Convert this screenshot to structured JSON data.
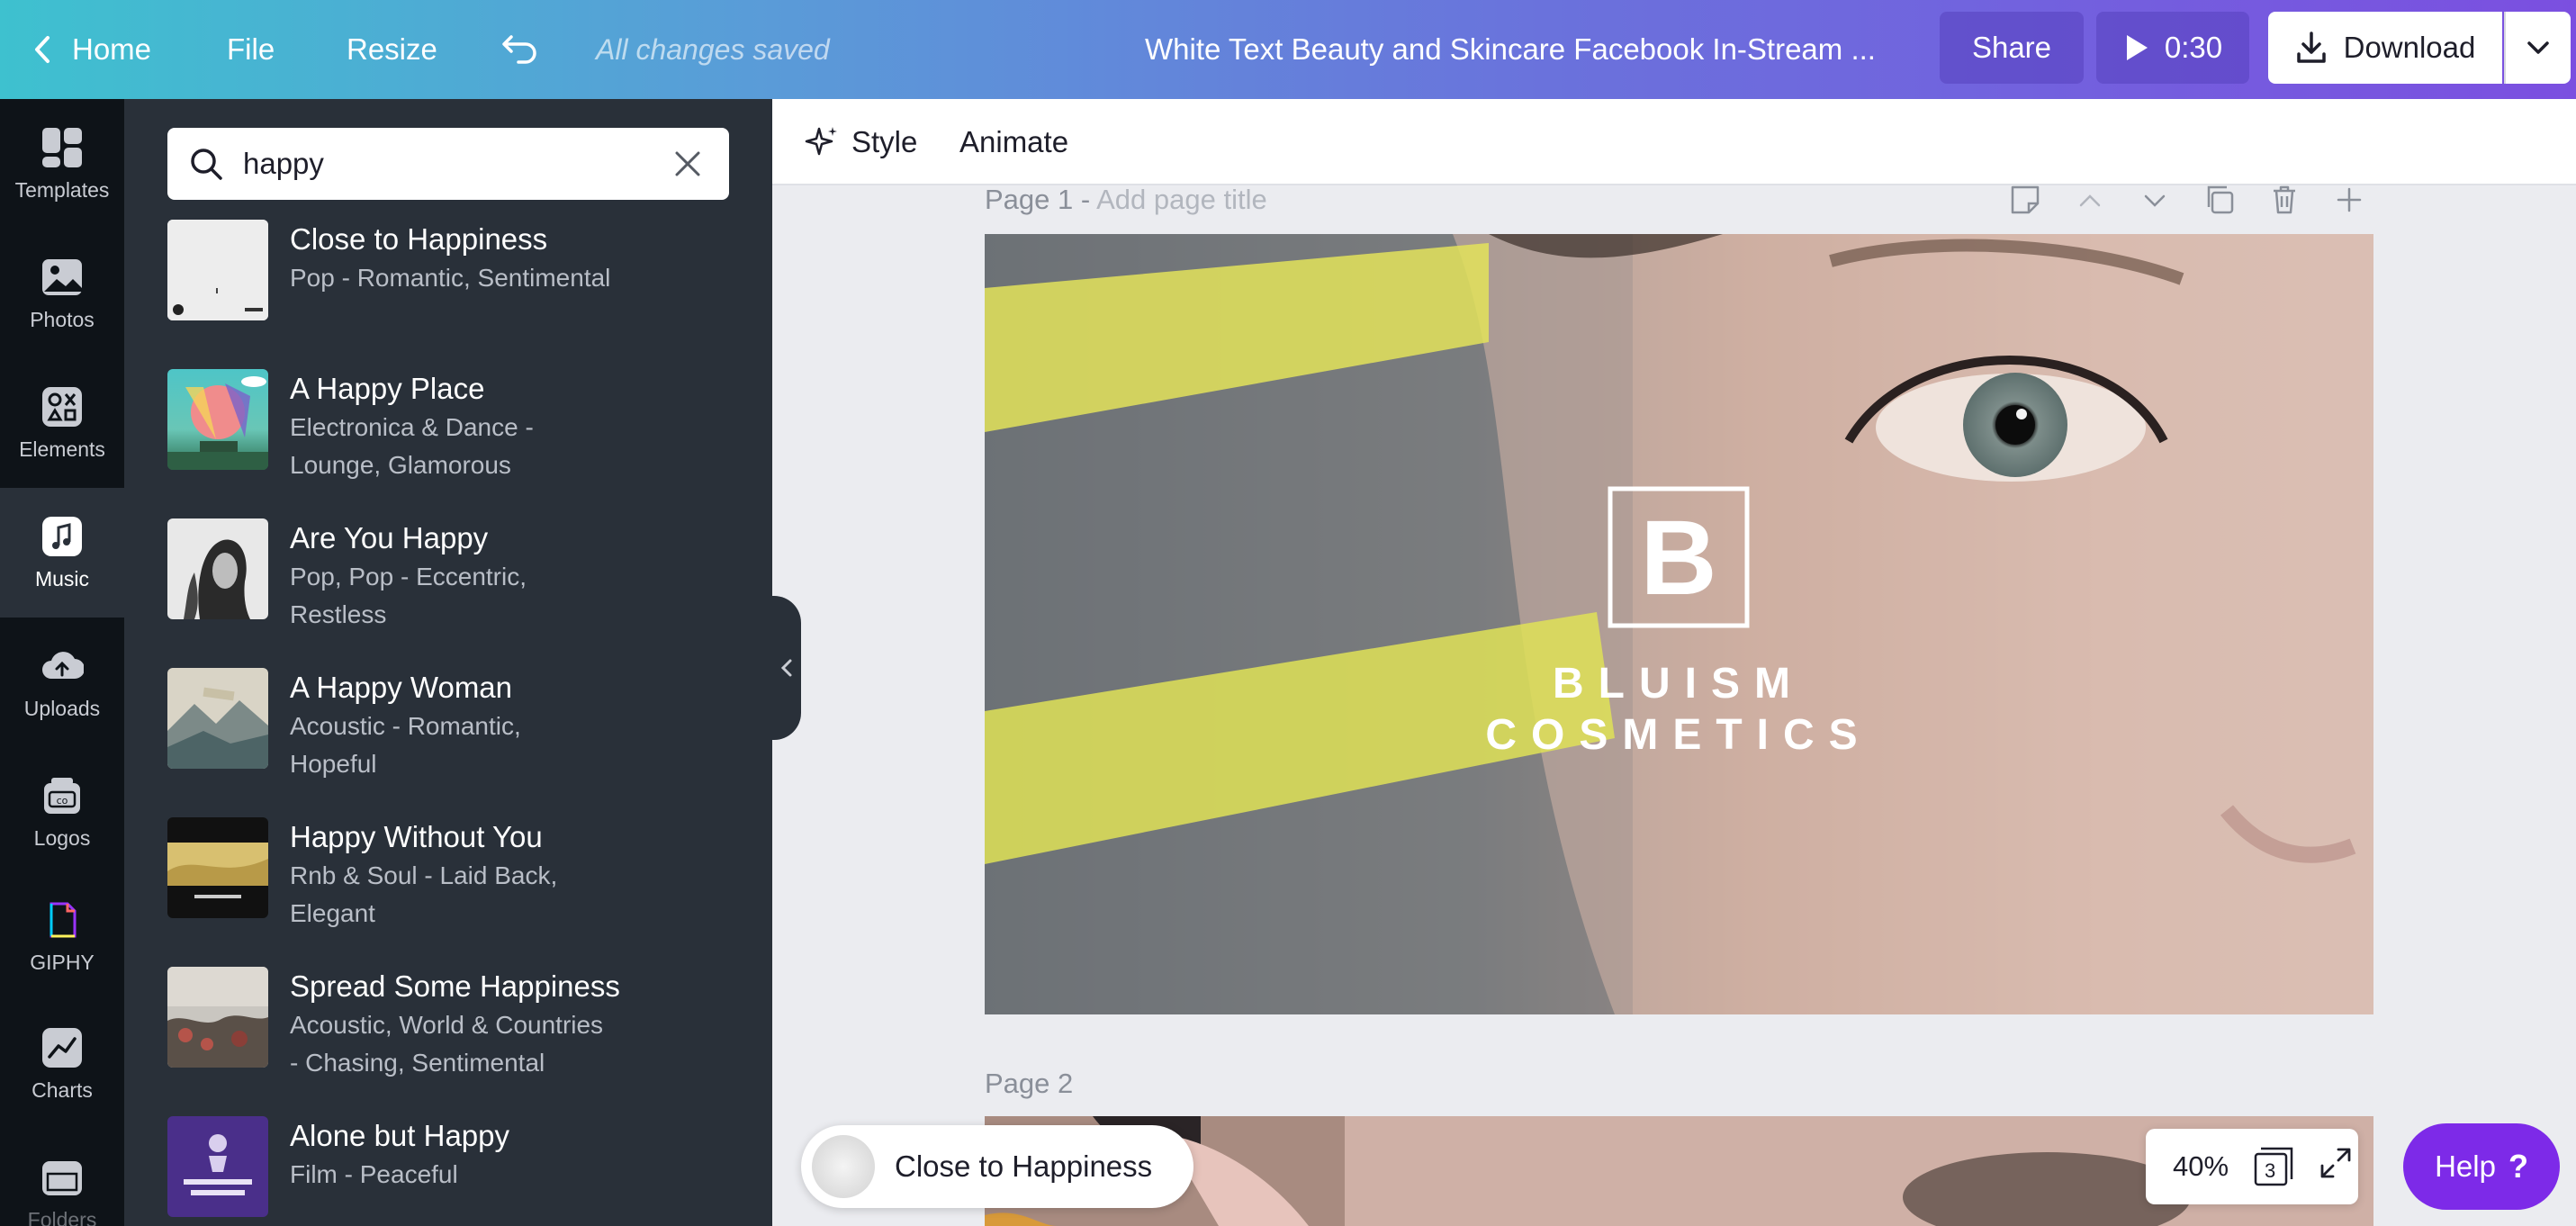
{
  "topbar": {
    "home_label": "Home",
    "file_label": "File",
    "resize_label": "Resize",
    "saved_status": "All changes saved",
    "design_title": "White Text Beauty and Skincare Facebook In-Stream ...",
    "share_label": "Share",
    "play_duration": "0:30",
    "download_label": "Download"
  },
  "rail": {
    "items": [
      {
        "label": "Templates",
        "icon": "templates-icon"
      },
      {
        "label": "Photos",
        "icon": "photos-icon"
      },
      {
        "label": "Elements",
        "icon": "elements-icon"
      },
      {
        "label": "Music",
        "icon": "music-icon"
      },
      {
        "label": "Uploads",
        "icon": "uploads-icon"
      },
      {
        "label": "Logos",
        "icon": "logos-icon"
      },
      {
        "label": "GIPHY",
        "icon": "giphy-icon"
      },
      {
        "label": "Charts",
        "icon": "charts-icon"
      },
      {
        "label": "Folders",
        "icon": "folders-icon"
      }
    ]
  },
  "search": {
    "value": "happy"
  },
  "tracks": [
    {
      "title": "Close to Happiness",
      "meta": "Pop - Romantic, Sentimental"
    },
    {
      "title": "A Happy Place",
      "meta": "Electronica & Dance - Lounge, Glamorous"
    },
    {
      "title": "Are You Happy",
      "meta": "Pop, Pop - Eccentric, Restless"
    },
    {
      "title": "A Happy Woman",
      "meta": "Acoustic - Romantic, Hopeful"
    },
    {
      "title": "Happy Without You",
      "meta": "Rnb & Soul - Laid Back, Elegant"
    },
    {
      "title": "Spread Some Happiness",
      "meta": "Acoustic, World & Countries - Chasing, Sentimental"
    },
    {
      "title": "Alone but Happy",
      "meta": "Film - Peaceful"
    }
  ],
  "editor": {
    "style_label": "Style",
    "animate_label": "Animate",
    "page1_label": "Page 1 -",
    "page1_title_placeholder": "Add page title",
    "page2_label": "Page 2"
  },
  "canvas": {
    "logo_letter": "B",
    "brand_line1": "BLUISM",
    "brand_line2": "COSMETICS"
  },
  "now_playing": {
    "title": "Close to Happiness"
  },
  "zoom": {
    "level": "40%",
    "page_count": "3"
  },
  "help": {
    "label": "Help",
    "glyph": "?"
  },
  "colors": {
    "accent": "#7d2ae8",
    "panel": "#293039",
    "rail": "#0e1318"
  }
}
